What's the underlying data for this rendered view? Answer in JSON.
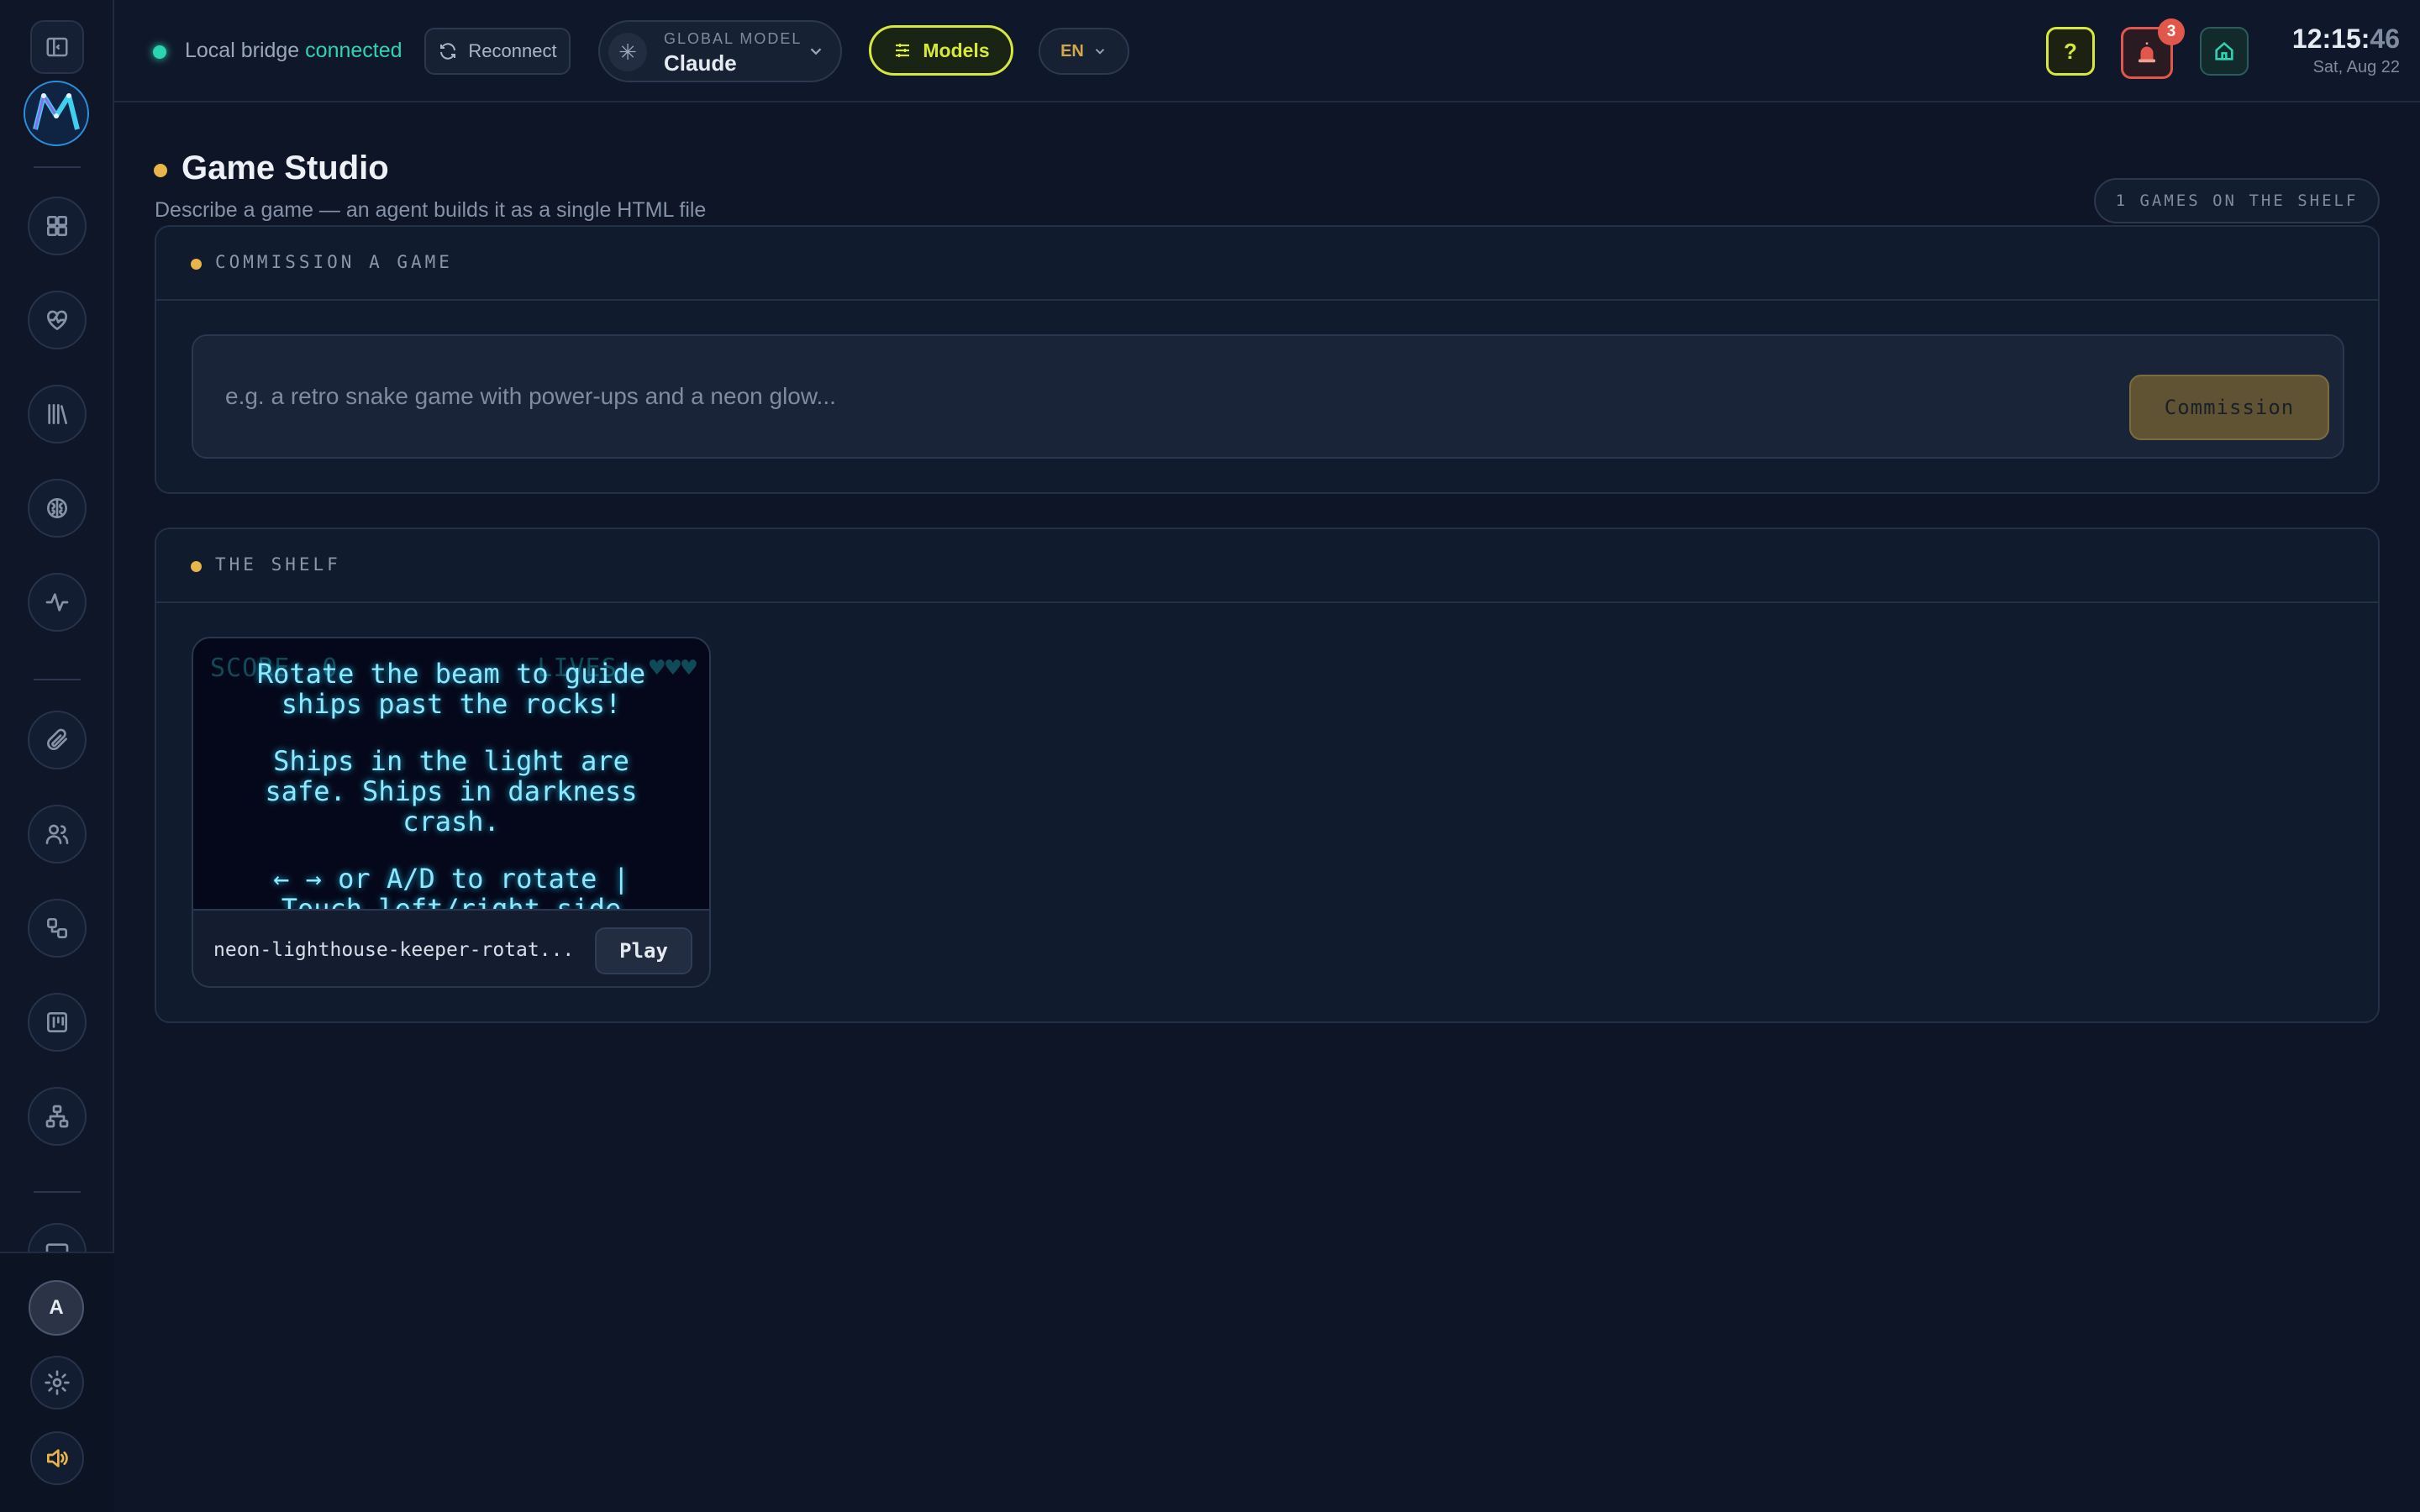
{
  "topbar": {
    "bridge_label": "Local bridge",
    "bridge_status": "connected",
    "reconnect_label": "Reconnect",
    "model_label": "GLOBAL MODEL",
    "model_name": "Claude",
    "models_label": "Models",
    "language": "EN",
    "help_label": "?",
    "alert_count": "3",
    "clock_hm": "12:15:",
    "clock_sec": "46",
    "date": "Sat, Aug 22"
  },
  "sidebar": {
    "avatar_initial": "A",
    "icons": [
      "panel-toggle-icon",
      "grid-icon",
      "heart-pulse-icon",
      "library-icon",
      "brain-icon",
      "activity-icon",
      "paperclip-icon",
      "users-icon",
      "workflow-icon",
      "kanban-icon",
      "network-icon",
      "monitor-icon",
      "settings-icon",
      "volume-icon"
    ]
  },
  "page": {
    "title": "Game Studio",
    "subtitle": "Describe a game — an agent builds it as a single HTML file",
    "shelf_count": "1 GAMES ON THE SHELF"
  },
  "commission": {
    "header": "COMMISSION A GAME",
    "placeholder": "e.g. a retro snake game with power-ups and a neon glow...",
    "button": "Commission"
  },
  "shelf": {
    "header": "THE SHELF",
    "games": [
      {
        "name": "neon-lighthouse-keeper-rotat...",
        "play_label": "Play",
        "preview_score": "SCORE: 0",
        "preview_lives": "LIVES: ♥♥♥",
        "preview_line1": "Rotate the beam to guide ships past the rocks!",
        "preview_line2": "Ships in the light are safe. Ships in darkness crash.",
        "preview_line3": "← → or A/D to rotate | Touch left/right side"
      }
    ]
  },
  "colors": {
    "accent_yellow": "#d6e83a",
    "accent_teal": "#2dd4b4",
    "accent_gold": "#e8b54a",
    "alert_red": "#e2574c"
  }
}
